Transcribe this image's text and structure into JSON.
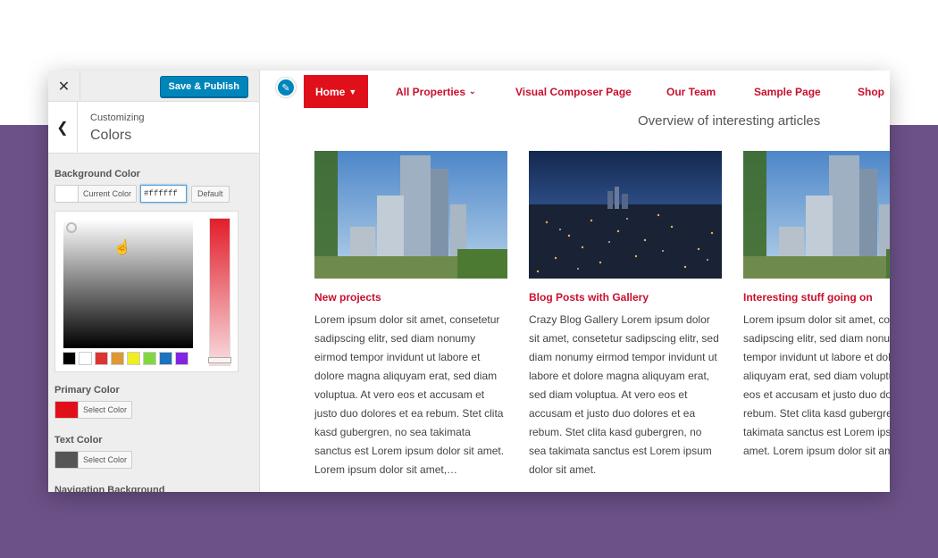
{
  "sidebar": {
    "publish_label": "Save & Publish",
    "breadcrumb": "Customizing",
    "title": "Colors",
    "background_color": {
      "label": "Background Color",
      "current_label": "Current Color",
      "current_color": "#ffffff",
      "hex_value": "#ffffff",
      "default_label": "Default"
    },
    "palette": [
      "#000000",
      "#ffffff",
      "#dd3333",
      "#dd9933",
      "#eeee22",
      "#81d742",
      "#1e73be",
      "#8224e3"
    ],
    "primary_color": {
      "label": "Primary Color",
      "button_label": "Select Color",
      "color": "#e0101a"
    },
    "text_color": {
      "label": "Text Color",
      "button_label": "Select Color",
      "color": "#555555"
    },
    "navigation_background": {
      "label": "Navigation Background"
    }
  },
  "preview": {
    "nav": [
      {
        "label": "Home",
        "active": true
      },
      {
        "label": "All Properties"
      },
      {
        "label": "Visual Composer Page"
      },
      {
        "label": "Our Team"
      },
      {
        "label": "Sample Page"
      },
      {
        "label": "Shop"
      }
    ],
    "overview_title": "Overview of interesting articles",
    "cards": [
      {
        "title": "New projects",
        "image": "skyscraper-photo",
        "body": "Lorem ipsum dolor sit amet, consetetur sadipscing elitr, sed diam nonumy eirmod tempor invidunt ut labore et dolore magna aliquyam erat, sed diam voluptua. At vero eos et accusam et justo duo dolores et ea rebum. Stet clita kasd gubergren, no sea takimata sanctus est Lorem ipsum dolor sit amet. Lorem ipsum dolor sit amet,…"
      },
      {
        "title": "Blog Posts with Gallery",
        "image": "city-night-photo",
        "body": "Crazy Blog Gallery Lorem ipsum dolor sit amet, consetetur sadipscing elitr, sed diam nonumy eirmod tempor invidunt ut labore et dolore magna aliquyam erat, sed diam voluptua. At vero eos et accusam et justo duo dolores et ea rebum. Stet clita kasd gubergren, no sea takimata sanctus est Lorem ipsum dolor sit amet."
      },
      {
        "title": "Interesting stuff going on",
        "image": "skyscraper-photo",
        "body": "Lorem ipsum dolor sit amet, consetetur sadipscing elitr, sed diam nonumy eirmod tempor invidunt ut labore et dolore magna aliquyam erat, sed diam voluptua. At vero eos et accusam et justo duo dolores et ea rebum. Stet clita kasd gubergren, no sea takimata sanctus est Lorem ipsum dolor sit amet. Lorem ipsum dolor sit amet,…"
      }
    ]
  },
  "colors": {
    "accent": "#c8102e",
    "nav_active_bg": "#e0101a",
    "publish_bg": "#0085ba",
    "page_bg": "#6c5188"
  }
}
